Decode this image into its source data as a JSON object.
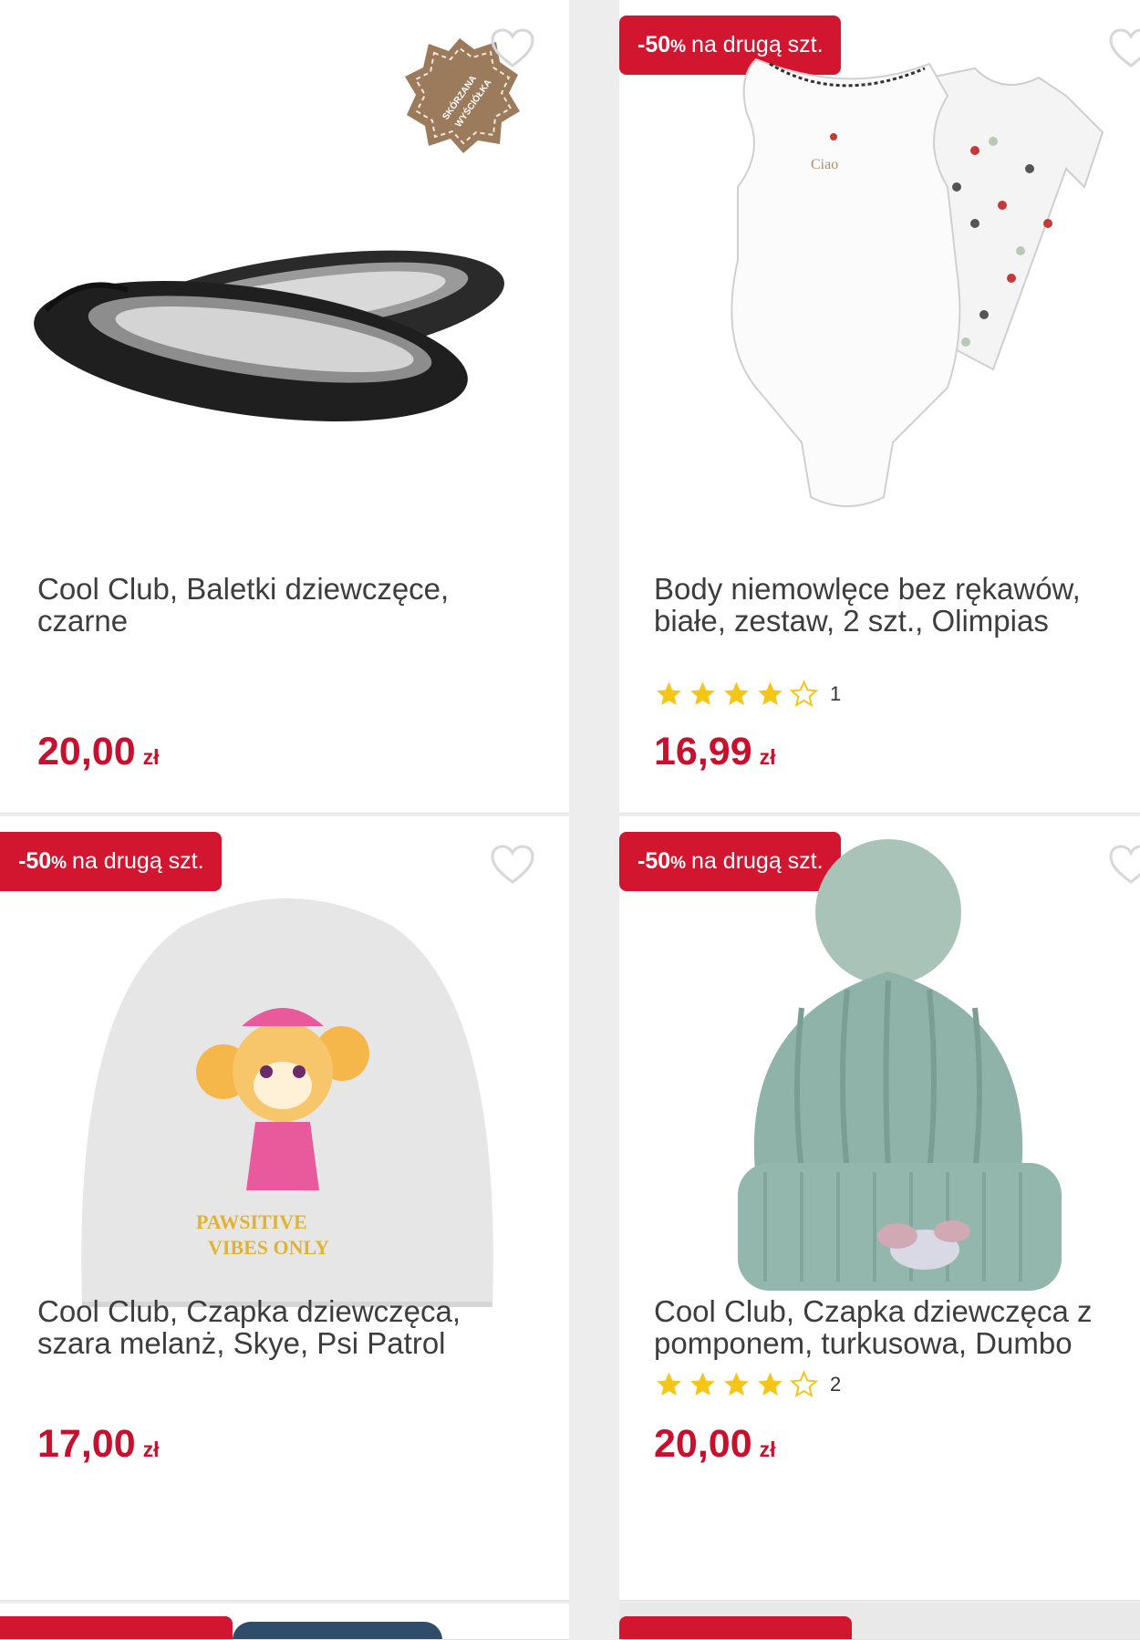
{
  "products": [
    {
      "title": "Cool Club, Baletki dziewczęce, czarne",
      "price": "20,00",
      "currency": "zł",
      "badge": null,
      "leather_badge": [
        "SKÓRZANA",
        "WYŚCIÓŁKA"
      ],
      "image": "black-ballet-shoes"
    },
    {
      "title": "Body niemowlęce bez rękawów, białe, zestaw, 2 szt., Olimpias",
      "price": "16,99",
      "currency": "zł",
      "badge": {
        "pct": "-50",
        "sign": "%",
        "text": "na drugą szt."
      },
      "rating": {
        "stars": 4,
        "max": 5,
        "count": "1"
      },
      "image": "white-baby-bodysuits"
    },
    {
      "title": "Cool Club, Czapka dziewczęca, szara melanż, Skye, Psi Patrol",
      "price": "17,00",
      "currency": "zł",
      "badge": {
        "pct": "-50",
        "sign": "%",
        "text": "na drugą szt."
      },
      "image": "grey-beanie-skye"
    },
    {
      "title": "Cool Club, Czapka dziewczęca z pomponem, turkusowa, Dumbo",
      "price": "20,00",
      "currency": "zł",
      "badge": {
        "pct": "-50",
        "sign": "%",
        "text": "na drugą szt."
      },
      "rating": {
        "stars": 4,
        "max": 5,
        "count": "2"
      },
      "image": "turquoise-pompom-hat"
    }
  ],
  "colors": {
    "accent": "#c8102e",
    "badge": "#d2162f",
    "star": "#f5c518",
    "text": "#3d3d3d"
  }
}
